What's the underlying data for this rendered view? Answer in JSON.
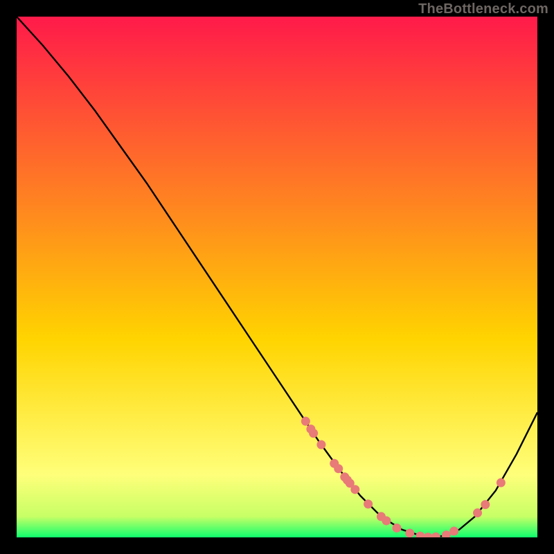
{
  "watermark": "TheBottleneck.com",
  "colors": {
    "grad_top": "#ff1a4a",
    "grad_mid": "#ffd400",
    "grad_low": "#ffff7a",
    "grad_bottom": "#0eff6e",
    "curve": "#000000",
    "dot": "#e87a78",
    "bg": "#000000"
  },
  "chart_data": {
    "type": "line",
    "title": "",
    "xlabel": "",
    "ylabel": "",
    "xlim": [
      0,
      100
    ],
    "ylim": [
      0,
      100
    ],
    "series": [
      {
        "name": "bottleneck-curve",
        "x": [
          0,
          5,
          10,
          15,
          20,
          25,
          30,
          35,
          40,
          45,
          50,
          55,
          58,
          62,
          66,
          70,
          74,
          78,
          80,
          82,
          85,
          88,
          92,
          96,
          100
        ],
        "y": [
          100,
          94.5,
          88.5,
          82,
          75,
          68,
          60.5,
          53,
          45.5,
          38,
          30.5,
          23,
          18.5,
          13,
          8,
          4,
          1.5,
          0.2,
          0,
          0.3,
          1.5,
          4,
          9,
          16,
          24
        ]
      }
    ],
    "scatter_points": {
      "name": "marked-points",
      "x": [
        55.5,
        56.5,
        57,
        58.5,
        61,
        61.8,
        63,
        63.5,
        64,
        65,
        67.5,
        70,
        71,
        73,
        75.5,
        77.5,
        79,
        80.5,
        82.5,
        84,
        88.5,
        90,
        93
      ],
      "y": [
        22.3,
        20.8,
        20,
        17.8,
        14.2,
        13.2,
        11.6,
        11,
        10.4,
        9.2,
        6.4,
        4,
        3.2,
        1.8,
        0.8,
        0.25,
        0.05,
        0.1,
        0.45,
        1.2,
        4.7,
        6.3,
        10.5
      ]
    }
  }
}
